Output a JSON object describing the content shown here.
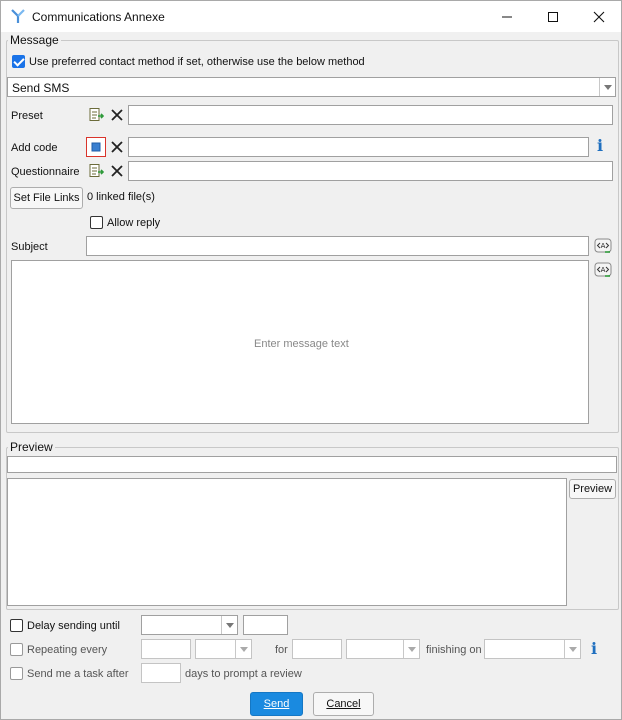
{
  "window": {
    "title": "Communications Annexe"
  },
  "message": {
    "legend": "Message",
    "use_preferred_label": "Use preferred contact method if set, otherwise use the below method",
    "use_preferred_checked": true,
    "method_value": "Send SMS",
    "preset_label": "Preset",
    "preset_value": "",
    "add_code_label": "Add code",
    "add_code_value": "",
    "questionnaire_label": "Questionnaire",
    "questionnaire_value": "",
    "set_file_links_label": "Set File Links",
    "linked_files_text": "0 linked file(s)",
    "allow_reply_label": "Allow reply",
    "allow_reply_checked": false,
    "subject_label": "Subject",
    "subject_value": "",
    "message_placeholder": "Enter message text"
  },
  "preview": {
    "legend": "Preview",
    "button_label": "Preview"
  },
  "schedule": {
    "delay_label": "Delay sending until",
    "repeating_label": "Repeating every",
    "for_label": "for",
    "finishing_label": "finishing on",
    "task_label": "Send me a task after",
    "days_label": "days to prompt a review"
  },
  "footer": {
    "send_label": "Send",
    "cancel_label": "Cancel"
  },
  "colors": {
    "accent": "#1a8ae0",
    "info": "#1f6fbf",
    "checkbox": "#1a73e8",
    "add_code_border": "#d9342b"
  },
  "icons": [
    "app-logo-icon",
    "minimize-icon",
    "maximize-icon",
    "close-icon",
    "pick-list-icon",
    "clear-x-icon",
    "add-code-icon",
    "info-icon",
    "insert-field-icon",
    "dropdown-arrow-icon"
  ]
}
